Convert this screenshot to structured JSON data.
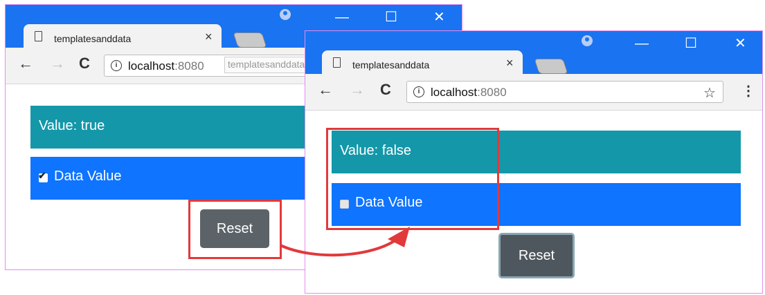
{
  "browser1": {
    "tab_title": "templatesanddata",
    "tab_close": "×",
    "url_host": "localhost",
    "url_port": ":8080",
    "tooltip": "templatesanddata",
    "value_text": "Value: true",
    "checkbox_label": "Data Value",
    "checkbox_checked": true,
    "reset_label": "Reset"
  },
  "browser2": {
    "tab_title": "templatesanddata",
    "tab_close": "×",
    "url_host": "localhost",
    "url_port": ":8080",
    "value_text": "Value: false",
    "checkbox_label": "Data Value",
    "checkbox_checked": false,
    "reset_label": "Reset"
  },
  "controls": {
    "minimize": "—",
    "maximize": "☐",
    "close": "✕",
    "back": "←",
    "forward": "→",
    "reload": "C",
    "info": "i",
    "star": "☆",
    "menu": "⋮",
    "checkmark": "✔"
  },
  "colors": {
    "titlebar": "#1a73f0",
    "teal_bar": "#1497a9",
    "blue_bar": "#0f74ff",
    "button": "#5b6369",
    "highlight": "#e2393b",
    "window_border": "#e58cf2"
  },
  "icons": [
    "page-icon",
    "profile-icon",
    "minimize-icon",
    "maximize-icon",
    "close-icon",
    "back-icon",
    "forward-icon",
    "reload-icon",
    "info-icon",
    "star-icon",
    "menu-icon",
    "arrow-icon"
  ]
}
